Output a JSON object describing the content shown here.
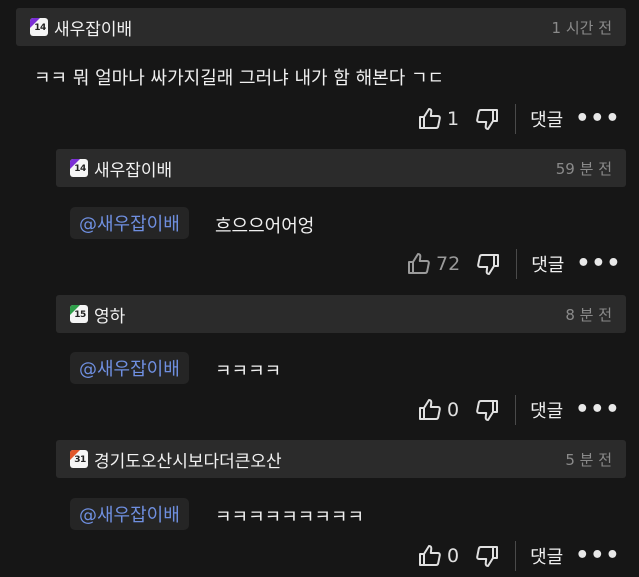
{
  "comments": [
    {
      "badge": {
        "text": "14",
        "color": "#7b2fd6"
      },
      "user": "새우잡이배",
      "time": "1 시간 전",
      "mention": "",
      "text": "ㅋㅋ 뭐 얼마나 싸가지길래 그러냐 내가 함 해본다 ㄱㄷ",
      "likes": "1"
    },
    {
      "badge": {
        "text": "14",
        "color": "#7b2fd6"
      },
      "user": "새우잡이배",
      "time": "59 분 전",
      "mention": "@새우잡이배",
      "text": "흐으으어어엉",
      "likes": "72"
    },
    {
      "badge": {
        "text": "15",
        "color": "#2f9e4a"
      },
      "user": "영하",
      "time": "8 분 전",
      "mention": "@새우잡이배",
      "text": "ㅋㅋㅋㅋ",
      "likes": "0"
    },
    {
      "badge": {
        "text": "31",
        "color": "#e0562a"
      },
      "user": "경기도오산시보다더큰오산",
      "time": "5 분 전",
      "mention": "@새우잡이배",
      "text": "ㅋㅋㅋㅋㅋㅋㅋㅋㅋ",
      "likes": "0"
    }
  ],
  "labels": {
    "reply": "댓글",
    "more": "•••"
  }
}
